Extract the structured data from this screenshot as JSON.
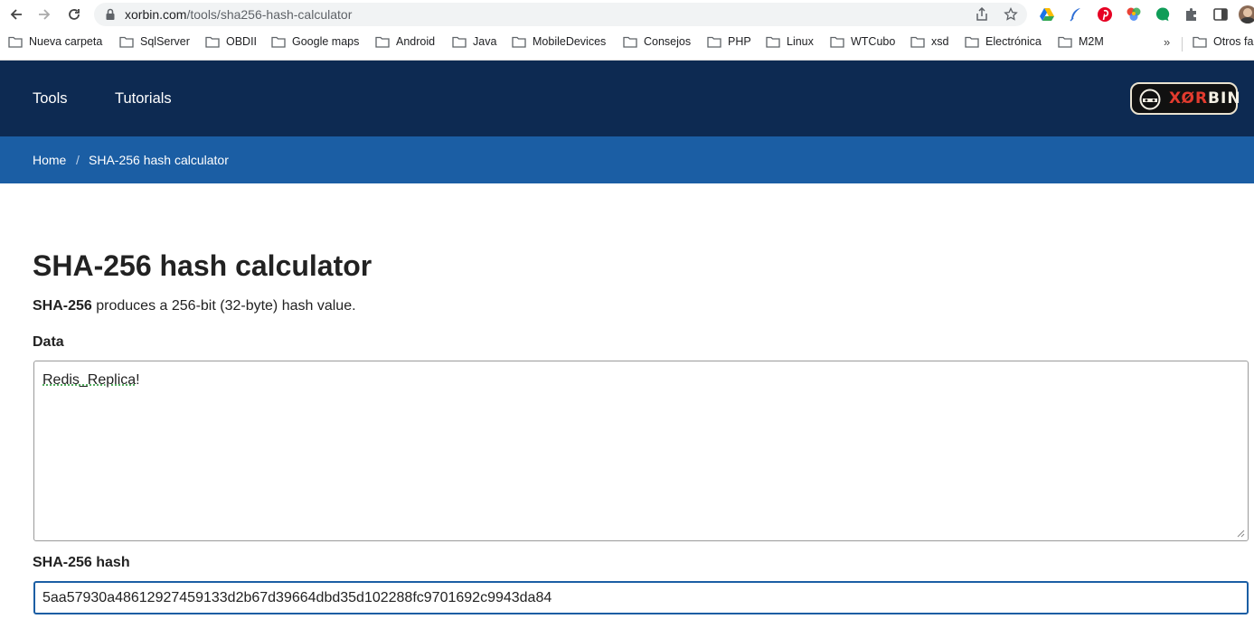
{
  "browser": {
    "url_host": "xorbin.com",
    "url_path": "/tools/sha256-hash-calculator"
  },
  "bookmarks": {
    "items": [
      "Nueva carpeta",
      "SqlServer",
      "OBDII",
      "Google maps",
      "Android",
      "Java",
      "MobileDevices",
      "Consejos",
      "PHP",
      "Linux",
      "WTCubo",
      "xsd",
      "Electrónica",
      "M2M"
    ],
    "more": "»",
    "other": "Otros fa"
  },
  "site": {
    "nav": [
      "Tools",
      "Tutorials"
    ],
    "logo_text_red": "XØR",
    "logo_text_white": "BIN",
    "breadcrumb": {
      "home": "Home",
      "separator": "/",
      "current": "SHA-256 hash calculator"
    }
  },
  "main": {
    "title": "SHA-256 hash calculator",
    "desc_bold": "SHA-256",
    "desc_rest": " produces a 256-bit (32-byte) hash value.",
    "data_label": "Data",
    "data_value_spell": "Redis_Replica",
    "data_value_tail": "!",
    "hash_label": "SHA-256 hash",
    "hash_value": "5aa57930a48612927459133d2b67d39664dbd35d102288fc9701692c9943da84"
  },
  "colors": {
    "nav_bg": "#0d2a52",
    "breadcrumb_bg": "#1b5ea4",
    "focus_border": "#1b5ea4"
  },
  "icons": [
    "back-icon",
    "forward-icon",
    "reload-icon",
    "lock-icon",
    "share-icon",
    "star-icon",
    "google-drive-icon",
    "extension-feather-icon",
    "pinterest-icon",
    "color-wheel-icon",
    "chat-bubble-icon",
    "puzzle-icon",
    "side-panel-icon",
    "profile-avatar",
    "folder-icon"
  ]
}
